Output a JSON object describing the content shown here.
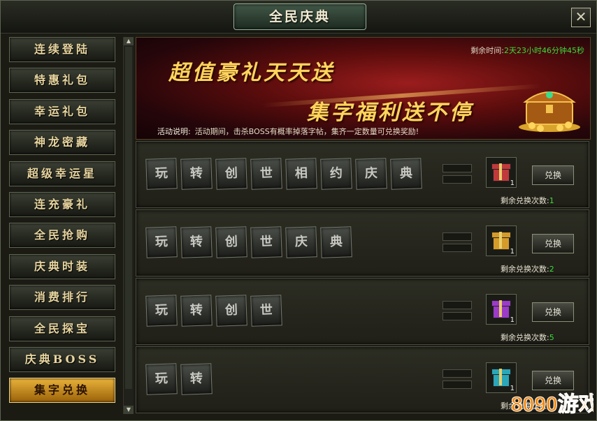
{
  "window": {
    "title": "全民庆典",
    "close_label": "✕"
  },
  "sidebar": {
    "items": [
      {
        "label": "连续登陆",
        "active": false
      },
      {
        "label": "特惠礼包",
        "active": false
      },
      {
        "label": "幸运礼包",
        "active": false
      },
      {
        "label": "神龙密藏",
        "active": false
      },
      {
        "label": "超级幸运星",
        "active": false
      },
      {
        "label": "连充豪礼",
        "active": false
      },
      {
        "label": "全民抢购",
        "active": false
      },
      {
        "label": "庆典时装",
        "active": false
      },
      {
        "label": "消费排行",
        "active": false
      },
      {
        "label": "全民探宝",
        "active": false
      },
      {
        "label": "庆典BOSS",
        "active": false
      },
      {
        "label": "集字兑换",
        "active": true
      }
    ]
  },
  "banner": {
    "title_line1": "超值豪礼天天送",
    "title_line2": "集字福利送不停",
    "countdown_label": "剩余时间:",
    "countdown_value": "2天23小时46分钟45秒",
    "activity_label": "活动说明:",
    "activity_text": "活动期间，击杀BOSS有概率掉落字帖，集齐一定数量可兑换奖励!",
    "icon": "treasure-chest-icon"
  },
  "rows": [
    {
      "chars": [
        "玩",
        "转",
        "创",
        "世",
        "相",
        "约",
        "庆",
        "典"
      ],
      "gift_color": "#c0393b",
      "gift_qty": "1",
      "button": "兑换",
      "remain_label": "剩余兑换次数:",
      "remain_count": "1"
    },
    {
      "chars": [
        "玩",
        "转",
        "创",
        "世",
        "庆",
        "典"
      ],
      "gift_color": "#d49a2a",
      "gift_qty": "1",
      "button": "兑换",
      "remain_label": "剩余兑换次数:",
      "remain_count": "2"
    },
    {
      "chars": [
        "玩",
        "转",
        "创",
        "世"
      ],
      "gift_color": "#9b3bc8",
      "gift_qty": "1",
      "button": "兑换",
      "remain_label": "剩余兑换次数:",
      "remain_count": "5"
    },
    {
      "chars": [
        "玩",
        "转"
      ],
      "gift_color": "#2aa7b8",
      "gift_qty": "1",
      "button": "兑换",
      "remain_label": "剩余兑换次数:",
      "remain_count": ""
    }
  ],
  "watermark": {
    "text": "8090游戏"
  },
  "colors": {
    "accent_gold": "#e9b33b",
    "count_green": "#3bdc3b",
    "banner_gold": "#ffd55c"
  }
}
